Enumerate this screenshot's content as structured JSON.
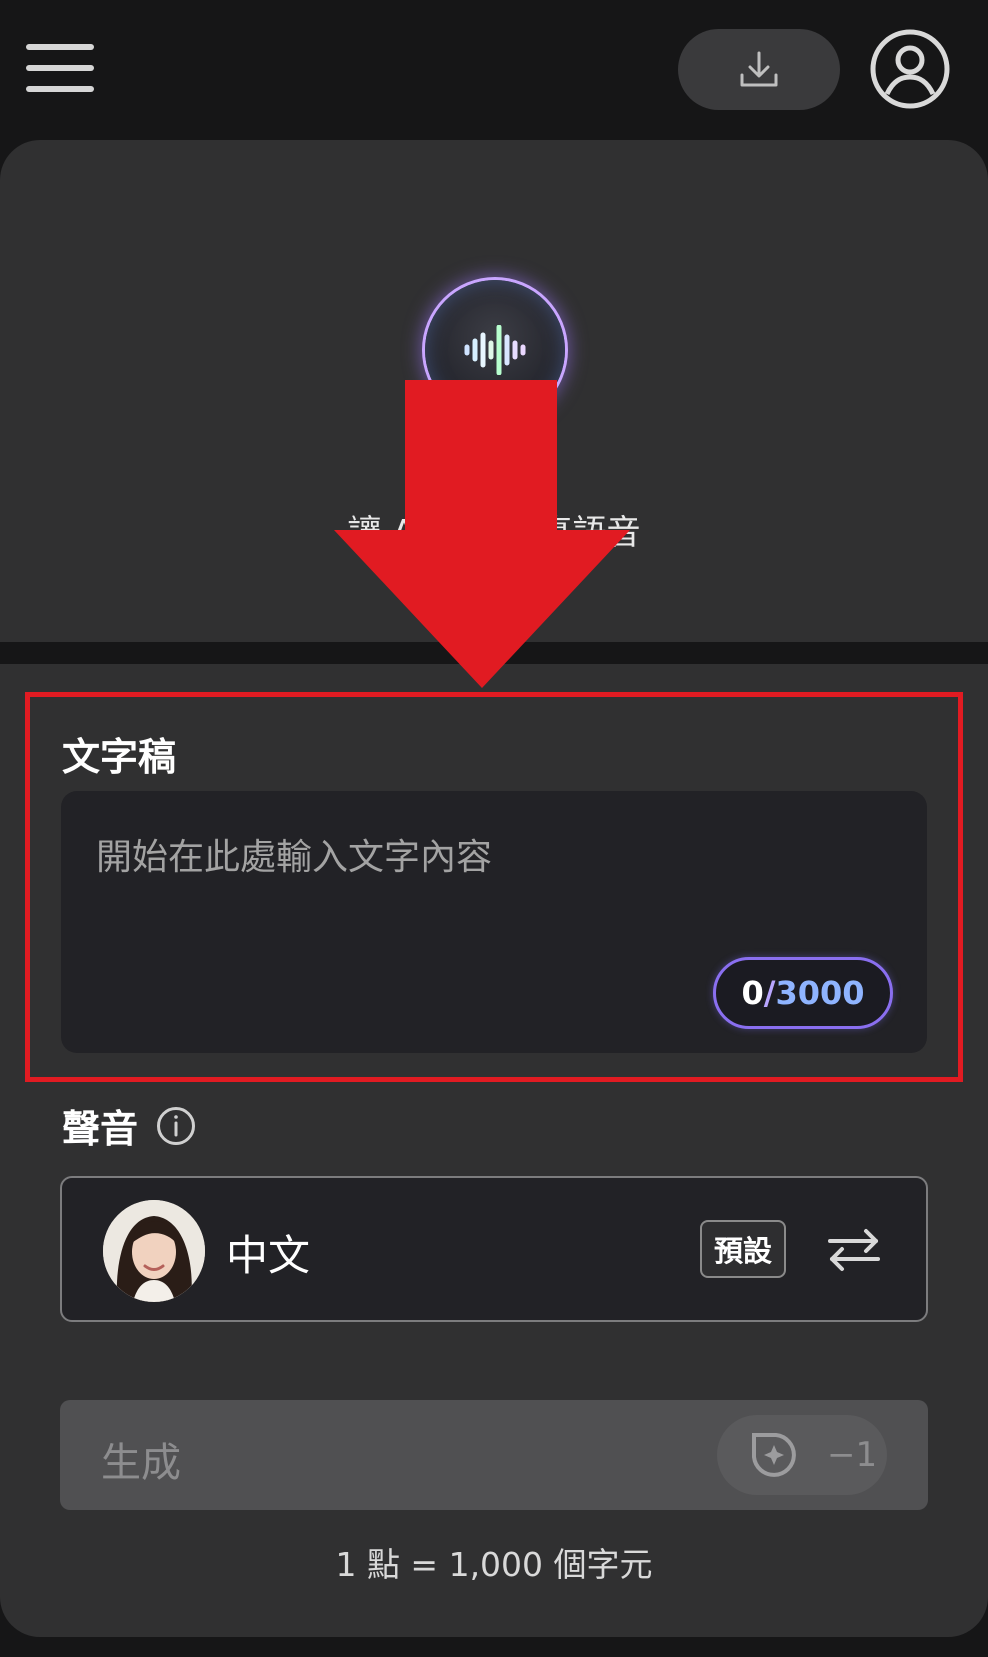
{
  "icons": {
    "menu": "hamburger-menu-icon",
    "download": "download-icon",
    "profile": "user-profile-icon",
    "hero": "sound-wave-icon",
    "info": "info-icon",
    "swap": "swap-arrows-icon",
    "credit": "credit-coin-icon"
  },
  "hero": {
    "text": "讓 AI 生成逼真語音"
  },
  "script": {
    "title": "文字稿",
    "placeholder": "開始在此處輸入文字內容",
    "count_current": "0",
    "count_separator": "/",
    "count_max": "3000"
  },
  "voice": {
    "title": "聲音",
    "name": "中文",
    "default_tag": "預設"
  },
  "generate": {
    "label": "生成",
    "cost": "−1"
  },
  "note": "1 點 = 1,000 個字元",
  "colors": {
    "highlight": "#e11b22",
    "arrow": "#e11b22",
    "counter_border": "#8a6ff0"
  }
}
